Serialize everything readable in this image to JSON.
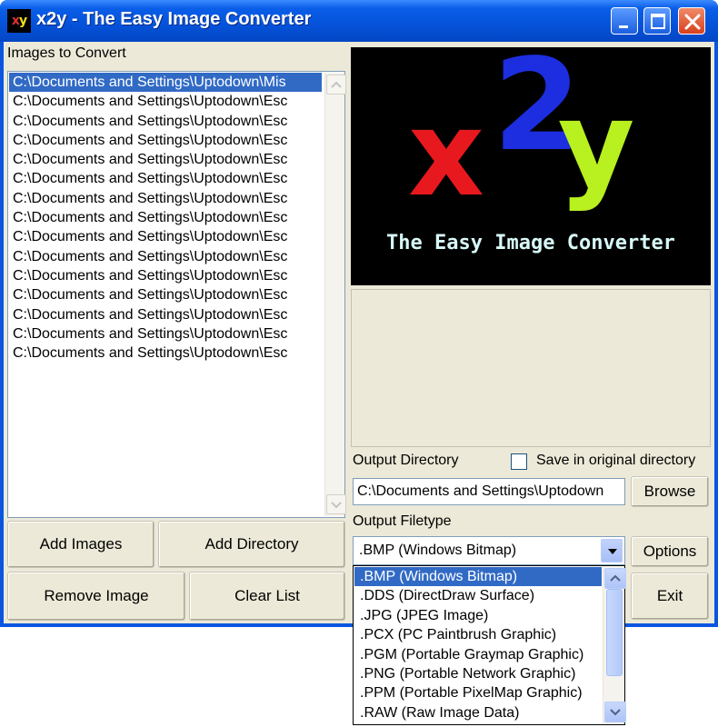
{
  "window": {
    "title": "x2y - The Easy Image Converter",
    "icon_text_x": "x",
    "icon_text_y": "y",
    "titlebar_color": "#0552d9",
    "close_color": "#d8401c"
  },
  "images_panel": {
    "label": "Images to Convert",
    "files": [
      "C:\\Documents and Settings\\Uptodown\\Mis",
      "C:\\Documents and Settings\\Uptodown\\Esc",
      "C:\\Documents and Settings\\Uptodown\\Esc",
      "C:\\Documents and Settings\\Uptodown\\Esc",
      "C:\\Documents and Settings\\Uptodown\\Esc",
      "C:\\Documents and Settings\\Uptodown\\Esc",
      "C:\\Documents and Settings\\Uptodown\\Esc",
      "C:\\Documents and Settings\\Uptodown\\Esc",
      "C:\\Documents and Settings\\Uptodown\\Esc",
      "C:\\Documents and Settings\\Uptodown\\Esc",
      "C:\\Documents and Settings\\Uptodown\\Esc",
      "C:\\Documents and Settings\\Uptodown\\Esc",
      "C:\\Documents and Settings\\Uptodown\\Esc",
      "C:\\Documents and Settings\\Uptodown\\Esc",
      "C:\\Documents and Settings\\Uptodown\\Esc"
    ],
    "selected_index": 0
  },
  "buttons": {
    "add_images": "Add Images",
    "add_directory": "Add Directory",
    "remove_image": "Remove Image",
    "clear_list": "Clear List",
    "browse": "Browse",
    "options": "Options",
    "exit": "Exit"
  },
  "logo": {
    "letter_x": "x",
    "letter_2": "2",
    "letter_y": "y",
    "tagline": "The Easy Image Converter",
    "color_x": "#e8191e",
    "color_2": "#1c2ee0",
    "color_y": "#b8f020",
    "tagline_color": "#d8f8f8"
  },
  "output": {
    "directory_label": "Output Directory",
    "save_original_label": "Save in original directory",
    "save_original_checked": false,
    "directory_value": "C:\\Documents and Settings\\Uptodown",
    "filetype_label": "Output Filetype",
    "filetype_selected": ".BMP (Windows Bitmap)",
    "filetype_options": [
      ".BMP (Windows Bitmap)",
      ".DDS (DirectDraw Surface)",
      ".JPG (JPEG Image)",
      ".PCX (PC Paintbrush Graphic)",
      ".PGM (Portable Graymap Graphic)",
      ".PNG (Portable Network Graphic)",
      ".PPM (Portable PixelMap Graphic)",
      ".RAW (Raw Image Data)"
    ],
    "highlight_color": "#316ac5"
  }
}
